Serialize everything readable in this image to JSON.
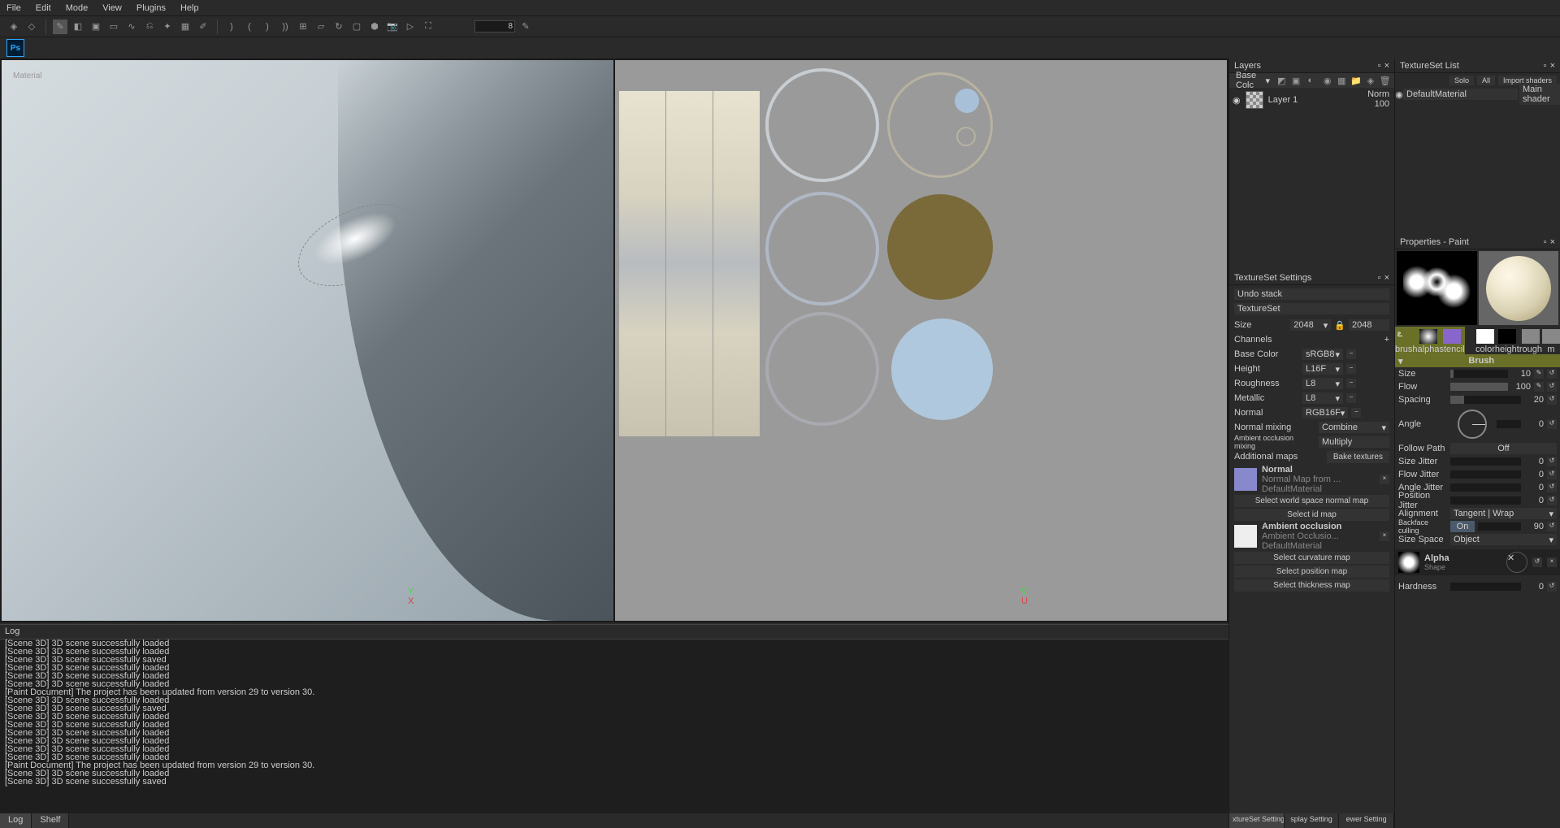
{
  "menu": [
    "File",
    "Edit",
    "Mode",
    "View",
    "Plugins",
    "Help"
  ],
  "toolbar_value": "8",
  "ps_label": "Ps",
  "viewport_label": "Material",
  "axis": {
    "x": "X",
    "y": "Y",
    "u": "U",
    "v": "V"
  },
  "log": {
    "title": "Log",
    "lines": [
      "[Scene 3D] 3D scene successfully loaded",
      "[Scene 3D] 3D scene successfully loaded",
      "[Scene 3D] 3D scene successfully saved",
      "[Scene 3D] 3D scene successfully loaded",
      "[Scene 3D] 3D scene successfully loaded",
      "[Scene 3D] 3D scene successfully loaded",
      "[Paint Document] The project has been updated from version 29 to version 30.",
      "[Scene 3D] 3D scene successfully loaded",
      "[Scene 3D] 3D scene successfully saved",
      "[Scene 3D] 3D scene successfully loaded",
      "[Scene 3D] 3D scene successfully loaded",
      "[Scene 3D] 3D scene successfully loaded",
      "[Scene 3D] 3D scene successfully loaded",
      "[Scene 3D] 3D scene successfully loaded",
      "[Scene 3D] 3D scene successfully loaded",
      "[Paint Document] The project has been updated from version 29 to version 30.",
      "[Scene 3D] 3D scene successfully loaded",
      "[Scene 3D] 3D scene successfully saved"
    ],
    "tabs": [
      "Log",
      "Shelf"
    ]
  },
  "layers": {
    "title": "Layers",
    "channel": "Base Colc",
    "items": [
      {
        "name": "Layer 1",
        "blend": "Norm",
        "opacity": "100"
      }
    ]
  },
  "ts": {
    "title": "TextureSet Settings",
    "undo": "Undo stack",
    "tset": "TextureSet",
    "size_label": "Size",
    "size": "2048",
    "size_locked": "2048",
    "channels_label": "Channels",
    "channels": [
      {
        "name": "Base Color",
        "fmt": "sRGB8"
      },
      {
        "name": "Height",
        "fmt": "L16F"
      },
      {
        "name": "Roughness",
        "fmt": "L8"
      },
      {
        "name": "Metallic",
        "fmt": "L8"
      },
      {
        "name": "Normal",
        "fmt": "RGB16F"
      }
    ],
    "nmix_label": "Normal mixing",
    "nmix": "Combine",
    "aomix_label": "Ambient occlusion mixing",
    "aomix": "Multiply",
    "addmaps_label": "Additional maps",
    "bake": "Bake textures",
    "maps": [
      {
        "title": "Normal",
        "sub": "Normal Map from ... DefaultMaterial",
        "thumb": "#8888cc"
      },
      {
        "title": "Ambient occlusion",
        "sub": "Ambient Occlusio... DefaultMaterial",
        "thumb": "#eeeeee"
      }
    ],
    "actions": [
      "Select world space normal map",
      "Select id map",
      "Select curvature map",
      "Select position map",
      "Select thickness map"
    ],
    "bottom_tabs": [
      "xtureSet Setting",
      "splay Setting",
      "ewer Setting"
    ]
  },
  "tsl": {
    "title": "TextureSet List",
    "solo": "Solo",
    "all": "All",
    "import": "Import shaders",
    "material": "DefaultMaterial",
    "shader": "Main shader"
  },
  "props": {
    "title": "Properties - Paint",
    "ch_labels": [
      "brush",
      "alpha",
      "stencil",
      "",
      "color",
      "height",
      "rough",
      "m"
    ],
    "brush_hdr": "Brush",
    "size": {
      "label": "Size",
      "val": "10"
    },
    "flow": {
      "label": "Flow",
      "val": "100"
    },
    "spacing": {
      "label": "Spacing",
      "val": "20"
    },
    "angle": {
      "label": "Angle",
      "val": "0"
    },
    "follow": {
      "label": "Follow Path",
      "val": "Off"
    },
    "sjit": {
      "label": "Size Jitter",
      "val": "0"
    },
    "fjit": {
      "label": "Flow Jitter",
      "val": "0"
    },
    "ajit": {
      "label": "Angle Jitter",
      "val": "0"
    },
    "pjit": {
      "label": "Position Jitter",
      "val": "0"
    },
    "align": {
      "label": "Alignment",
      "val": "Tangent | Wrap"
    },
    "bcull": {
      "label": "Backface culling",
      "on": "On",
      "val": "90"
    },
    "sspace": {
      "label": "Size Space",
      "val": "Object"
    },
    "alpha": {
      "title": "Alpha",
      "sub": "Shape"
    },
    "hardness": {
      "label": "Hardness",
      "val": "0"
    }
  }
}
